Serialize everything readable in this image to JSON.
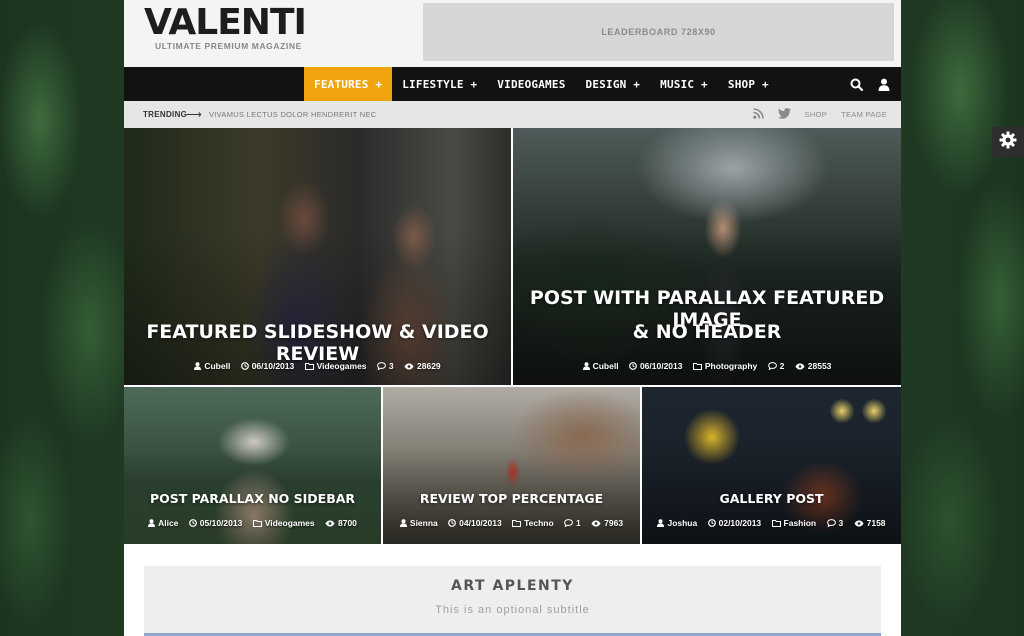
{
  "header": {
    "logo_title": "VALENTI",
    "logo_subtitle": "ULTIMATE PREMIUM MAGAZINE",
    "leaderboard_text": "LEADERBOARD 728X90"
  },
  "nav": {
    "items": [
      {
        "label": "FEATURES +"
      },
      {
        "label": "LIFESTYLE +"
      },
      {
        "label": "VIDEOGAMES"
      },
      {
        "label": "DESIGN +"
      },
      {
        "label": "MUSIC +"
      },
      {
        "label": "SHOP +"
      }
    ],
    "active_color": "#f0a50f",
    "icons": [
      "search-icon",
      "user-icon"
    ]
  },
  "trending": {
    "label": "TRENDING",
    "arrow": "⟶",
    "headline": "VIVAMUS LECTUS DOLOR HENDRERIT NEC",
    "links": [
      "SHOP",
      "TEAM PAGE"
    ],
    "icons": [
      "rss-icon",
      "twitter-icon"
    ]
  },
  "featured": [
    {
      "title": "FEATURED SLIDESHOW & VIDEO REVIEW",
      "author": "Cubell",
      "date": "06/10/2013",
      "category": "Videogames",
      "comments": "3",
      "views": "28629"
    },
    {
      "title_line1": "POST WITH PARALLAX FEATURED IMAGE",
      "title_line2": "& NO HEADER",
      "author": "Cubell",
      "date": "06/10/2013",
      "category": "Photography",
      "comments": "2",
      "views": "28553"
    },
    {
      "title": "POST PARALLAX NO SIDEBAR",
      "author": "Alice",
      "date": "05/10/2013",
      "category": "Videogames",
      "comments": "",
      "views": "8700"
    },
    {
      "title": "REVIEW TOP PERCENTAGE",
      "author": "Sienna",
      "date": "04/10/2013",
      "category": "Techno",
      "comments": "1",
      "views": "7963"
    },
    {
      "title": "GALLERY POST",
      "author": "Joshua",
      "date": "02/10/2013",
      "category": "Fashion",
      "comments": "3",
      "views": "7158"
    }
  ],
  "art_section": {
    "title": "ART APLENTY",
    "subtitle": "This is an optional subtitle"
  }
}
